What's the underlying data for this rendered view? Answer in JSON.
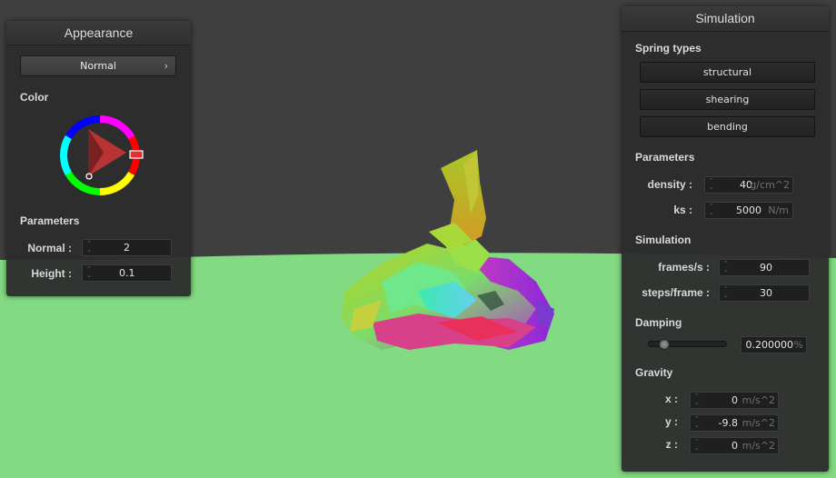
{
  "appearance": {
    "title": "Appearance",
    "mode": "Normal",
    "color_label": "Color",
    "color_hex": "#d23c3c",
    "params_label": "Parameters",
    "normal_label": "Normal :",
    "normal_value": "2",
    "height_label": "Height :",
    "height_value": "0.1"
  },
  "simulation": {
    "title": "Simulation",
    "spring_types_label": "Spring types",
    "spring_buttons": [
      "structural",
      "shearing",
      "bending"
    ],
    "params_label": "Parameters",
    "density_label": "density :",
    "density_value": "40",
    "density_unit": "g/cm^2",
    "ks_label": "ks :",
    "ks_value": "5000",
    "ks_unit": "N/m",
    "sim_label": "Simulation",
    "fps_label": "frames/s :",
    "fps_value": "90",
    "steps_label": "steps/frame :",
    "steps_value": "30",
    "damping_label": "Damping",
    "damping_value": "0.200000",
    "damping_unit": "%",
    "damping_level": 0.2,
    "gravity_label": "Gravity",
    "gx_label": "x :",
    "gx_value": "0",
    "gy_label": "y :",
    "gy_value": "-9.8",
    "gz_label": "z :",
    "gz_value": "0",
    "gravity_unit": "m/s^2"
  },
  "scene": {
    "ground_color": "#82da82",
    "background_color": "#3f3f3f"
  }
}
